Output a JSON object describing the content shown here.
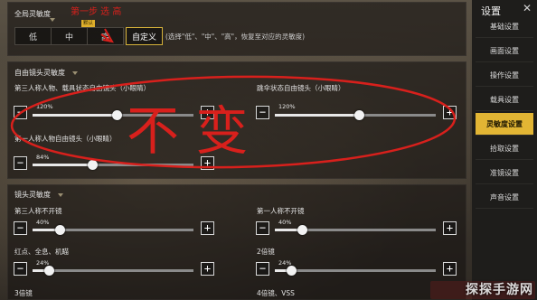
{
  "global_sensitivity": {
    "title": "全局灵敏度",
    "options": [
      "低",
      "中",
      "高",
      "自定义"
    ],
    "selected": "自定义",
    "badge": "默认",
    "hint": "(选择\"低\"、\"中\"、\"高\"，恢复至对应的灵敏度)"
  },
  "freelook": {
    "title": "自由镜头灵敏度",
    "sliders": [
      {
        "label": "第三人称人物、载具状态自由镜头（小眼睛）",
        "percent": "120%",
        "value": 0.52
      },
      {
        "label": "跳伞状态自由镜头（小眼睛）",
        "percent": "120%",
        "value": 0.52
      },
      {
        "label": "第一人称人物自由镜头（小眼睛）",
        "percent": "84%",
        "value": 0.37
      }
    ]
  },
  "camera": {
    "title": "镜头灵敏度",
    "sliders": [
      {
        "label": "第三人称不开镜",
        "percent": "40%",
        "value": 0.17
      },
      {
        "label": "第一人称不开镜",
        "percent": "40%",
        "value": 0.17
      },
      {
        "label": "红点、全息、机瞄",
        "percent": "24%",
        "value": 0.1
      },
      {
        "label": "2倍镜",
        "percent": "24%",
        "value": 0.1
      }
    ],
    "cut_labels": [
      "3倍镜",
      "4倍镜、VSS"
    ]
  },
  "sidebar": {
    "title": "设置",
    "items": [
      "基础设置",
      "画面设置",
      "操作设置",
      "载具设置",
      "灵敏度设置",
      "拾取设置",
      "准镜设置",
      "声音设置"
    ],
    "active": "灵敏度设置"
  },
  "annotation": {
    "step_text": "第一步 选 高",
    "big_text": "不 变"
  },
  "watermark": "探探手游网",
  "colors": {
    "accent": "#e2b534",
    "annotation_red": "#d8201c"
  }
}
